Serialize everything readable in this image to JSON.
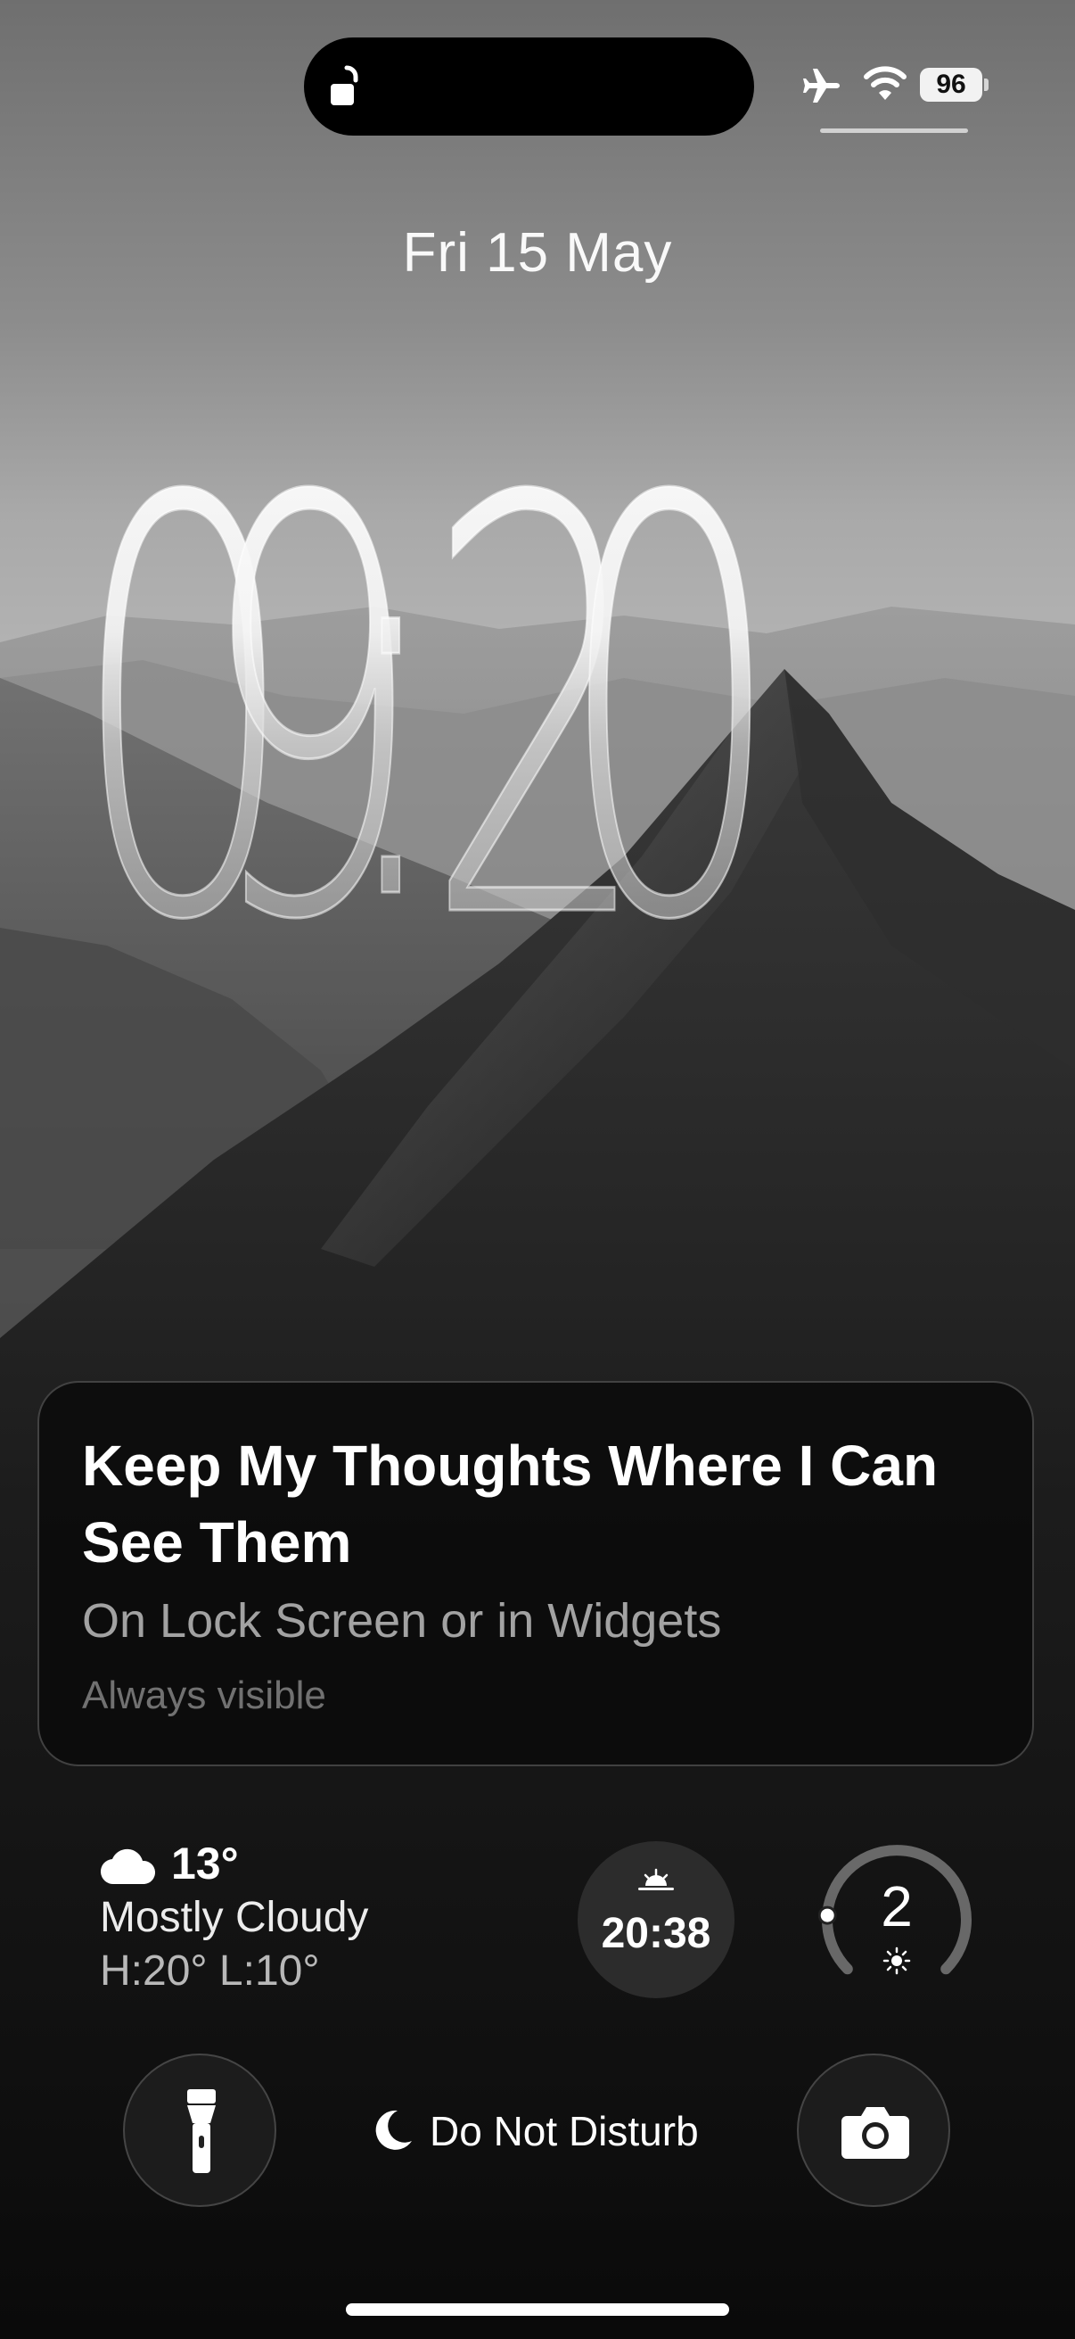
{
  "status_bar": {
    "battery_level": "96",
    "lock_state": "unlocked",
    "airplane_mode": true,
    "wifi": true
  },
  "lock_screen": {
    "date": "Fri 15 May",
    "time": {
      "h1": "0",
      "h2": "9",
      "separator": ":",
      "m1": "2",
      "m2": "0"
    }
  },
  "notes_widget": {
    "title": "Keep My Thoughts Where I Can See Them",
    "subtitle": "On Lock Screen or in Widgets",
    "caption": "Always visible"
  },
  "weather": {
    "icon": "cloud-icon",
    "temperature": "13°",
    "condition": "Mostly Cloudy",
    "high_low": "H:20° L:10°"
  },
  "sunset": {
    "icon": "sunset-icon",
    "time": "20:38"
  },
  "uv_index": {
    "value": "2",
    "level_fraction": 0.18,
    "icon": "sun-icon"
  },
  "controls": {
    "left": "flashlight-icon",
    "right": "camera-icon",
    "focus_icon": "moon-icon",
    "focus_label": "Do Not Disturb"
  },
  "colors": {
    "widget_bg": "#0a0a0a",
    "text_primary": "#ffffff",
    "text_secondary": "#9e9e9e"
  }
}
